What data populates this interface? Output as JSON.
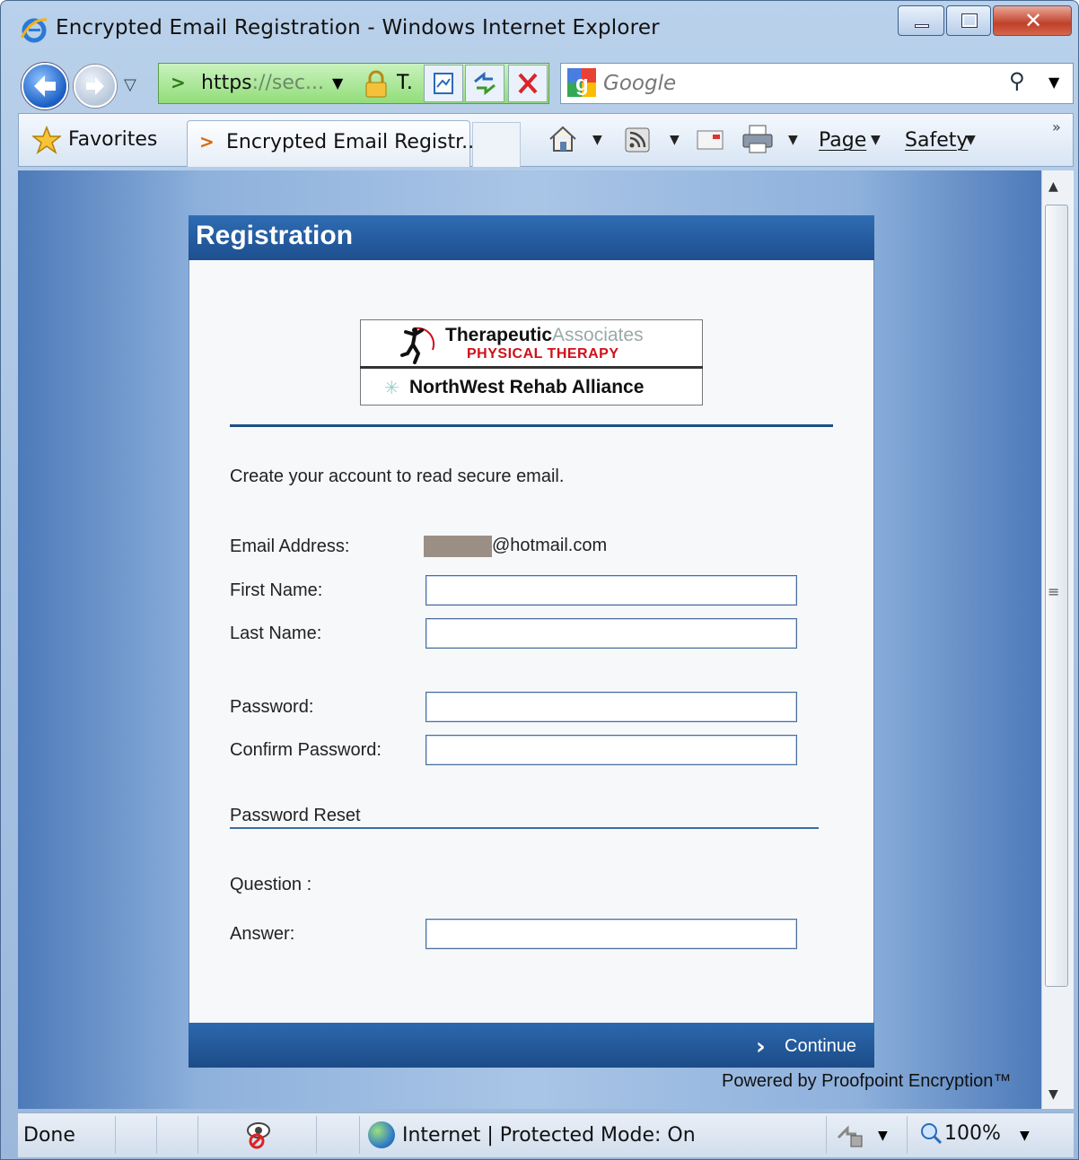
{
  "window": {
    "title": "Encrypted Email Registration - Windows Internet Explorer"
  },
  "address_bar": {
    "url_prefix": "https",
    "url_rest": "://sec...",
    "security_text": "T."
  },
  "search": {
    "placeholder": "Google"
  },
  "favorites": {
    "label": "Favorites"
  },
  "tab": {
    "label": "Encrypted Email Registr..."
  },
  "command_bar": {
    "page_label": "Page",
    "safety_label": "Safety"
  },
  "panel": {
    "title": "Registration",
    "intro": "Create your account to read secure email.",
    "logo": {
      "line1_bold": "Therapeutic",
      "line1_light": "Associates",
      "line2": "PHYSICAL THERAPY",
      "line3": "NorthWest Rehab Alliance"
    },
    "fields": {
      "email_label": "Email Address:",
      "email_value": "@hotmail.com",
      "first_name_label": "First Name:",
      "last_name_label": "Last Name:",
      "password_label": "Password:",
      "confirm_password_label": "Confirm Password:",
      "reset_section": "Password Reset",
      "question_label": "Question :",
      "answer_label": "Answer:"
    },
    "continue_label": "Continue",
    "powered_by": "Powered by Proofpoint Encryption™"
  },
  "status_bar": {
    "status": "Done",
    "zone": "Internet | Protected Mode: On",
    "zoom": "100%"
  },
  "icons": [
    "ie-icon",
    "back-icon",
    "forward-icon",
    "lock-icon",
    "compat-view-icon",
    "refresh-icon",
    "stop-icon",
    "google-icon",
    "search-icon",
    "favorites-star-icon",
    "home-icon",
    "feeds-icon",
    "read-mail-icon",
    "print-icon",
    "continue-chevron-icon",
    "globe-icon",
    "privacy-icon",
    "popup-icon",
    "zoom-icon"
  ]
}
